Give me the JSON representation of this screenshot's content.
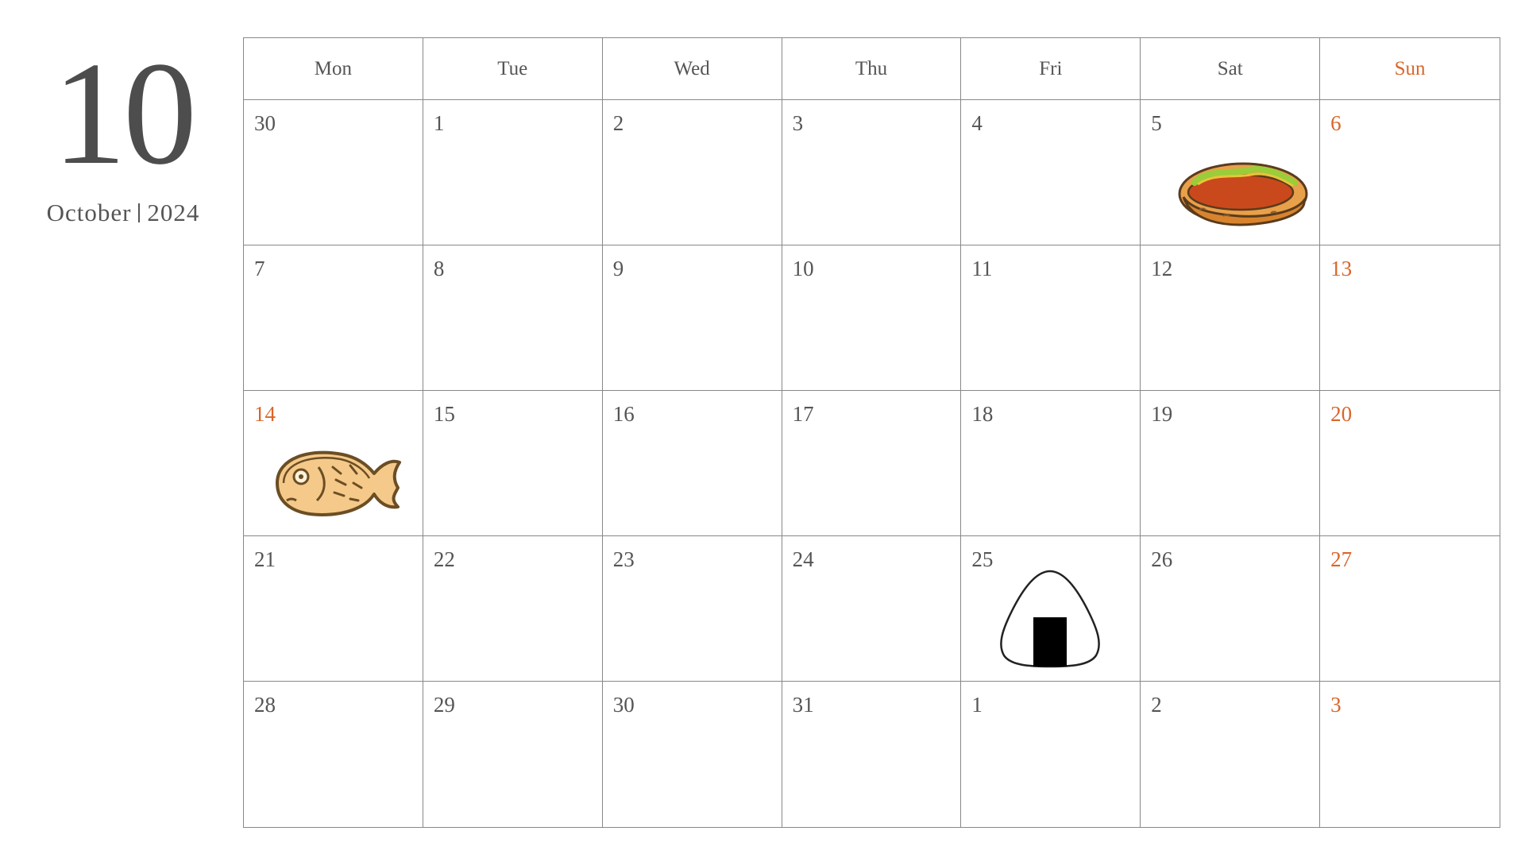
{
  "header": {
    "month_number": "10",
    "month_name": "October",
    "year": "2024"
  },
  "colors": {
    "text": "#555555",
    "sunday_holiday": "#d9662a",
    "grid": "#888888"
  },
  "weekdays": [
    "Mon",
    "Tue",
    "Wed",
    "Thu",
    "Fri",
    "Sat",
    "Sun"
  ],
  "weeks": [
    [
      "30",
      "1",
      "2",
      "3",
      "4",
      "5",
      "6"
    ],
    [
      "7",
      "8",
      "9",
      "10",
      "11",
      "12",
      "13"
    ],
    [
      "14",
      "15",
      "16",
      "17",
      "18",
      "19",
      "20"
    ],
    [
      "21",
      "22",
      "23",
      "24",
      "25",
      "26",
      "27"
    ],
    [
      "28",
      "29",
      "30",
      "31",
      "1",
      "2",
      "3"
    ]
  ],
  "highlighted_days": [
    "0-6",
    "1-6",
    "2-0",
    "2-6",
    "3-6",
    "4-6"
  ],
  "illustrations": [
    {
      "cell": "0-5",
      "icon": "hotdog-icon"
    },
    {
      "cell": "2-0",
      "icon": "taiyaki-icon"
    },
    {
      "cell": "3-4",
      "icon": "onigiri-icon"
    }
  ]
}
